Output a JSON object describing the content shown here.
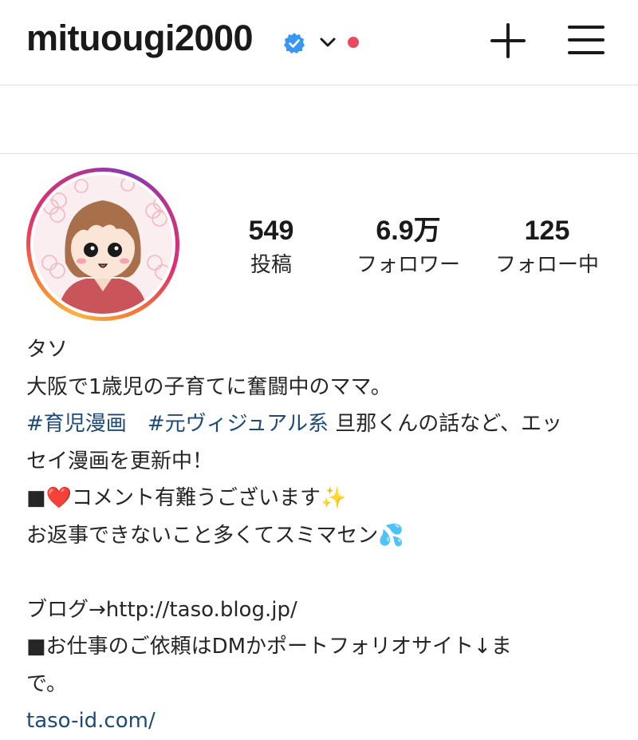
{
  "header": {
    "username": "mituougi2000",
    "verified_icon": "verified-badge-icon",
    "chevron_icon": "chevron-down-icon",
    "notification_dot_color": "#e84a5f",
    "new_post_icon": "plus-icon",
    "menu_icon": "hamburger-menu-icon"
  },
  "stats": {
    "posts": {
      "value": "549",
      "label": "投稿"
    },
    "followers": {
      "value": "6.9万",
      "label": "フォロワー"
    },
    "following": {
      "value": "125",
      "label": "フォロー中"
    }
  },
  "bio": {
    "name": "タソ",
    "line1": "大阪で1歳児の子育てに奮闘中のママ。",
    "hashtag1": "#育児漫画",
    "hashtag2": "#元ヴィジュアル系",
    "line2_rest": " 旦那くんの話など、エッ",
    "line3": "セイ漫画を更新中！",
    "line4": "■❤️コメント有難うございます✨",
    "line5": "お返事できないこと多くてスミマセン💦",
    "line6": "ブログ→http://taso.blog.jp/",
    "line7": "■お仕事のご依頼はDMかポートフォリオサイト↓ま",
    "line8": "で。",
    "link": "taso-id.com/"
  },
  "colors": {
    "link": "#1e4a78",
    "text": "#262626",
    "verified": "#3897f0"
  }
}
